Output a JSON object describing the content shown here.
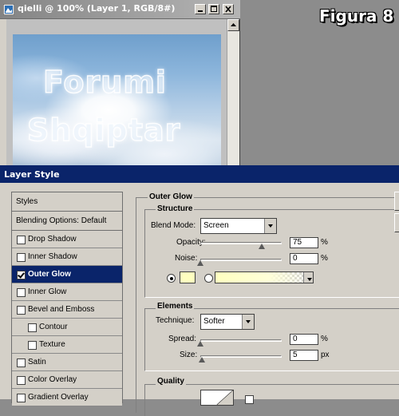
{
  "document_window": {
    "title": "qielli @ 100% (Layer 1, RGB/8#)",
    "watermark_lines": [
      "Forumi",
      "Shqiptar"
    ]
  },
  "figure_label": "Figura 8",
  "layer_style": {
    "title": "Layer Style",
    "styles_list": {
      "header": "Styles",
      "blending_options": "Blending Options: Default",
      "items": [
        {
          "label": "Drop Shadow",
          "checked": false,
          "indent": false,
          "selected": false
        },
        {
          "label": "Inner Shadow",
          "checked": false,
          "indent": false,
          "selected": false
        },
        {
          "label": "Outer Glow",
          "checked": true,
          "indent": false,
          "selected": true
        },
        {
          "label": "Inner Glow",
          "checked": false,
          "indent": false,
          "selected": false
        },
        {
          "label": "Bevel and Emboss",
          "checked": false,
          "indent": false,
          "selected": false
        },
        {
          "label": "Contour",
          "checked": false,
          "indent": true,
          "selected": false
        },
        {
          "label": "Texture",
          "checked": false,
          "indent": true,
          "selected": false
        },
        {
          "label": "Satin",
          "checked": false,
          "indent": false,
          "selected": false
        },
        {
          "label": "Color Overlay",
          "checked": false,
          "indent": false,
          "selected": false
        },
        {
          "label": "Gradient Overlay",
          "checked": false,
          "indent": false,
          "selected": false
        }
      ]
    },
    "outer_glow": {
      "title": "Outer Glow",
      "structure": {
        "title": "Structure",
        "blend_mode_label": "Blend Mode:",
        "blend_mode_value": "Screen",
        "opacity_label": "Opacity:",
        "opacity_value": "75",
        "opacity_unit": "%",
        "opacity_fraction": 0.75,
        "noise_label": "Noise:",
        "noise_value": "0",
        "noise_unit": "%",
        "noise_fraction": 0,
        "glow_color": "#ffffc0",
        "gradient_selected": false
      },
      "elements": {
        "title": "Elements",
        "technique_label": "Technique:",
        "technique_value": "Softer",
        "spread_label": "Spread:",
        "spread_value": "0",
        "spread_unit": "%",
        "spread_fraction": 0,
        "size_label": "Size:",
        "size_value": "5",
        "size_unit": "px",
        "size_fraction": 0.02
      },
      "quality": {
        "title": "Quality"
      }
    }
  }
}
